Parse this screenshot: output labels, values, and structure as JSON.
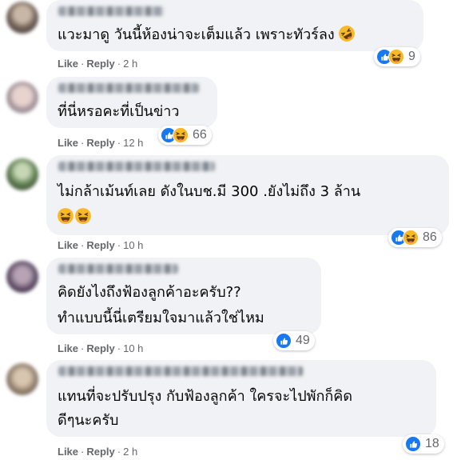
{
  "actions": {
    "like_label": "Like",
    "reply_label": "Reply",
    "separator": "·"
  },
  "colors": {
    "bubble": "#f0f2f5",
    "like_blue": "#1877f2",
    "haha_yellow": "#f7b928",
    "meta_gray": "#65676b"
  },
  "comments": [
    {
      "lines": [
        "แวะมาดู วันนี้ห้องน่าจะเต็มแล้ว เพราะทัวร์ลง"
      ],
      "emoji": "rolling-on-floor-laughing",
      "time": "2 h",
      "reactions": [
        "like",
        "haha"
      ],
      "count": "9"
    },
    {
      "lines": [
        "ที่นี่หรอคะที่เป็นข่าว"
      ],
      "time": "12 h",
      "reactions": [
        "like",
        "haha"
      ],
      "count": "66"
    },
    {
      "lines": [
        "ไม่กล้าเม้นท์เลย ดังในบช.มี 300 .ยังไม่ถึง 3 ล้าน"
      ],
      "emoji_line": "squinting-laughing x2",
      "time": "10 h",
      "reactions": [
        "like",
        "haha"
      ],
      "count": "86"
    },
    {
      "lines": [
        "คิดยังไงถึงฟ้องลูกค้าอะครับ??",
        "ทำแบบนี้นี่เตรียมใจมาแล้วใช่ไหม"
      ],
      "time": "10 h",
      "reactions": [
        "like"
      ],
      "count": "49"
    },
    {
      "lines": [
        "แทนที่จะปรับปรุง กับฟ้องลูกค้า ใครจะไปพักก็คิด",
        "ดีๆนะครับ"
      ],
      "time": "2 h",
      "reactions": [
        "like"
      ],
      "count": "18"
    }
  ]
}
